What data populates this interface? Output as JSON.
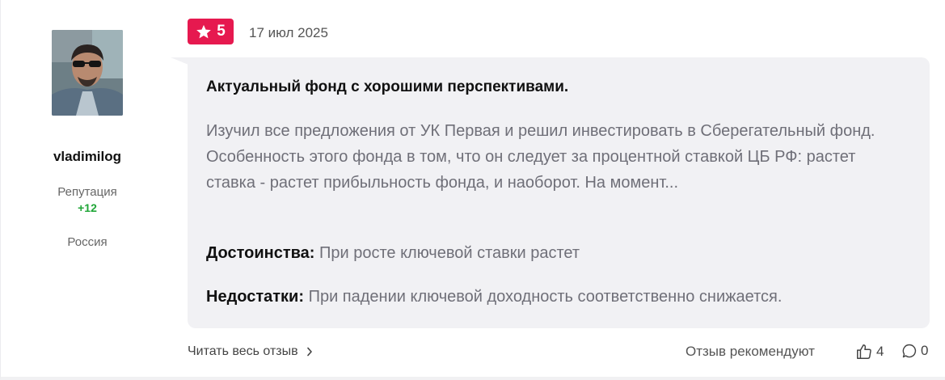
{
  "author": {
    "username": "vladimilog",
    "reputation_label": "Репутация",
    "reputation_value": "+12",
    "country": "Россия",
    "avatar_icon": "user-photo"
  },
  "review": {
    "rating": "5",
    "date": "17 июл 2025",
    "title": "Актуальный фонд с хорошими перспективами.",
    "text": "Изучил все предложения от УК Первая и решил инвестировать в Сберегательный фонд. Особенность этого фонда в том, что он следует за процентной ставкой ЦБ РФ: растет ставка - растет прибыльность фонда, и наоборот. На момент...",
    "pros_label": "Достоинства:",
    "pros_text": " При росте ключевой ставки растет",
    "cons_label": "Недостатки:",
    "cons_text": " При падении ключевой доходность соответственно снижается."
  },
  "footer": {
    "read_full_label": "Читать весь отзыв",
    "recommend_text": "Отзыв рекомендуют",
    "likes_count": "4",
    "comments_count": "0"
  },
  "colors": {
    "accent": "#e6194f",
    "reputation": "#1fa637",
    "bubble": "#f1f1f4"
  }
}
